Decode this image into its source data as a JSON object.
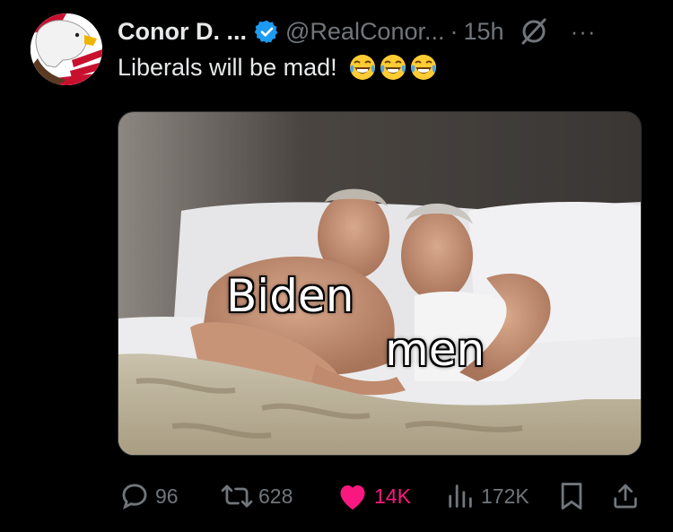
{
  "post": {
    "author_name": "Conor D. ...",
    "handle": "@RealConor...",
    "separator": "·",
    "time": "15h",
    "more_label": "···",
    "text": "Liberals will be mad!",
    "emoji": [
      "face-with-tears-of-joy-icon",
      "face-with-tears-of-joy-icon",
      "face-with-tears-of-joy-icon"
    ],
    "media": {
      "caption_left": "Biden",
      "caption_right": "men"
    }
  },
  "actions": {
    "replies": "96",
    "reposts": "628",
    "likes": "14K",
    "views": "172K"
  },
  "colors": {
    "background": "#000000",
    "text": "#e7e9ea",
    "muted": "#71767b",
    "verified": "#1d9bf0",
    "like": "#f91880"
  }
}
